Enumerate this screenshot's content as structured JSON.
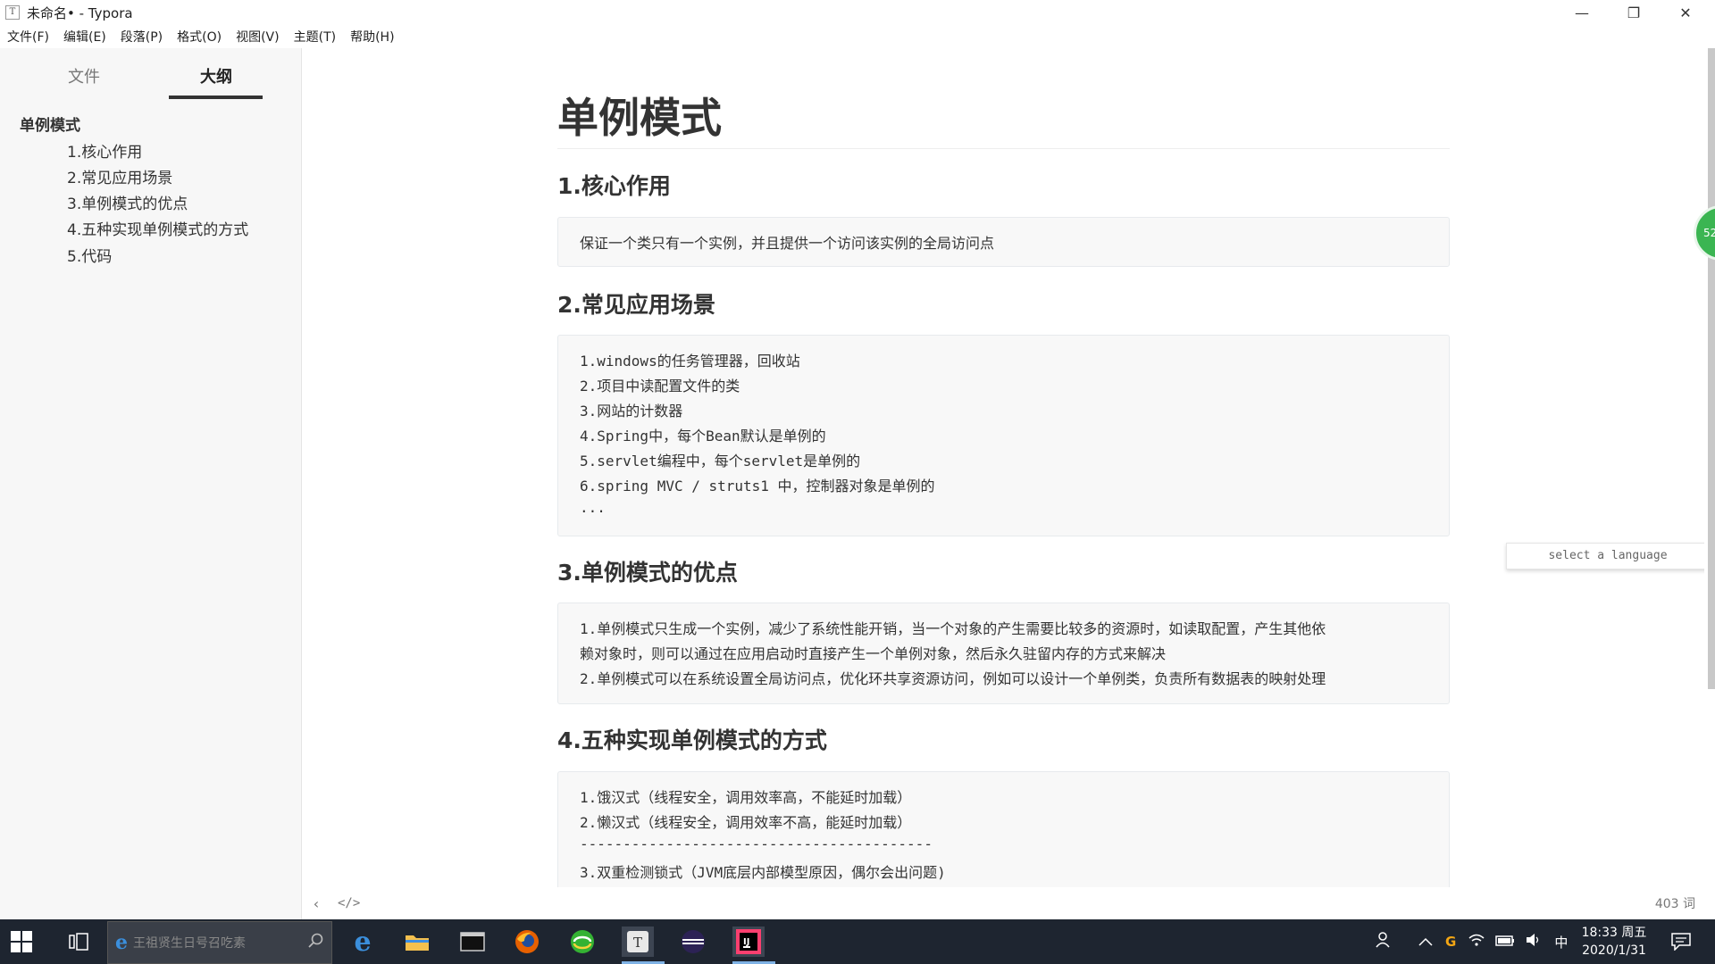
{
  "window": {
    "title": "未命名• - Typora",
    "icon_letter": "T",
    "minimize_label": "—",
    "restore_label": "❐",
    "close_label": "✕"
  },
  "menu": [
    "文件(F)",
    "编辑(E)",
    "段落(P)",
    "格式(O)",
    "视图(V)",
    "主题(T)",
    "帮助(H)"
  ],
  "sidebar": {
    "tabs": [
      {
        "label": "文件",
        "active": false
      },
      {
        "label": "大纲",
        "active": true
      }
    ],
    "outline_title": "单例模式",
    "outline_items": [
      "1.核心作用",
      "2.常见应用场景",
      "3.单例模式的优点",
      "4.五种实现单例模式的方式",
      "5.代码"
    ]
  },
  "document": {
    "title": "单例模式",
    "sections": [
      {
        "heading": "1.核心作用",
        "code_lines": [
          "保证一个类只有一个实例，并且提供一个访问该实例的全局访问点"
        ]
      },
      {
        "heading": "2.常见应用场景",
        "code_lines": [
          "1.windows的任务管理器，回收站",
          "2.项目中读配置文件的类",
          "3.网站的计数器",
          "4.Spring中，每个Bean默认是单例的",
          "5.servlet编程中，每个servlet是单例的",
          "6.spring MVC / struts1 中，控制器对象是单例的",
          "..."
        ]
      },
      {
        "heading": "3.单例模式的优点",
        "code_lines": [
          "1.单例模式只生成一个实例，减少了系统性能开销，当一个对象的产生需要比较多的资源时，如读取配置，产生其他依",
          "赖对象时，则可以通过在应用启动时直接产生一个单例对象，然后永久驻留内存的方式来解决",
          "2.单例模式可以在系统设置全局访问点，优化环共享资源访问，例如可以设计一个单例类，负责所有数据表的映射处理"
        ]
      },
      {
        "heading": "4.五种实现单例模式的方式",
        "code_lines": [
          "1.饿汉式（线程安全，调用效率高，不能延时加载）",
          "2.懒汉式（线程安全，调用效率不高，能延时加载）",
          "-----------------------------------------",
          "3.双重检测锁式（JVM底层内部模型原因，偶尔会出问题)"
        ]
      }
    ],
    "language_select_placeholder": "select a language"
  },
  "statusbar": {
    "back_icon": "‹",
    "source_toggle": "</>",
    "word_count": "403 词"
  },
  "badge_text": "52",
  "taskbar": {
    "search_placeholder": "王祖贤生日号召吃素",
    "clock_time": "18:33 周五",
    "clock_date": "2020/1/31",
    "ime_label": "中",
    "icons": [
      "start-icon",
      "task-view-icon",
      "edge-icon",
      "file-explorer-icon",
      "terminal-icon",
      "firefox-icon",
      "browser-360-icon",
      "typora-icon",
      "eclipse-icon",
      "intellij-icon"
    ]
  }
}
